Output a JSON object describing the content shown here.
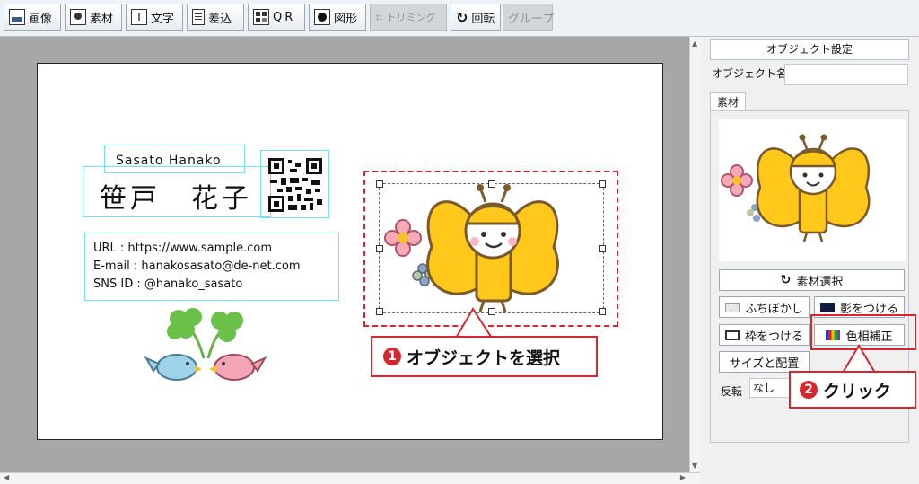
{
  "toolbar": {
    "buttons": [
      {
        "label": "画像",
        "icon": "image-icon",
        "enabled": true
      },
      {
        "label": "素材",
        "icon": "material-icon",
        "enabled": true
      },
      {
        "label": "文字",
        "icon": "text-icon",
        "enabled": true
      },
      {
        "label": "差込",
        "icon": "merge-icon",
        "enabled": true
      },
      {
        "label": "QR",
        "icon": "qr-icon",
        "enabled": true
      },
      {
        "label": "図形",
        "icon": "shape-icon",
        "enabled": true
      },
      {
        "label": "トリミング",
        "icon": "crop-icon",
        "enabled": false
      },
      {
        "label": "回転",
        "icon": "rotate-icon",
        "enabled": true
      },
      {
        "label": "グループ",
        "icon": "",
        "enabled": false
      }
    ]
  },
  "card": {
    "name_romaji": "Sasato Hanako",
    "name_kanji": "笹戸　花子",
    "url_line": "URL : https://www.sample.com",
    "email_line": "E-mail : hanakosasato@de-net.com",
    "sns_line": "SNS ID : @hanako_sasato"
  },
  "panel": {
    "header": "オブジェクト設定",
    "object_name_label": "オブジェクト名",
    "object_name_value": "",
    "tab_label": "素材",
    "select_material_label": "素材選択",
    "blur_label": "ふちぼかし",
    "shadow_label": "影をつける",
    "frame_label": "枠をつける",
    "hue_label": "色相補正",
    "size_position_label": "サイズと配置",
    "flip_label": "反転",
    "flip_value": "なし"
  },
  "callouts": {
    "step1_number": "1",
    "step1_text": "オブジェクトを選択",
    "step2_number": "2",
    "step2_text": "クリック"
  },
  "colors": {
    "accent_red": "#d8262e",
    "selection_cyan": "#6fe3ef",
    "butterfly_yellow": "#ffc81a",
    "outline_brown": "#7a5a2a"
  }
}
